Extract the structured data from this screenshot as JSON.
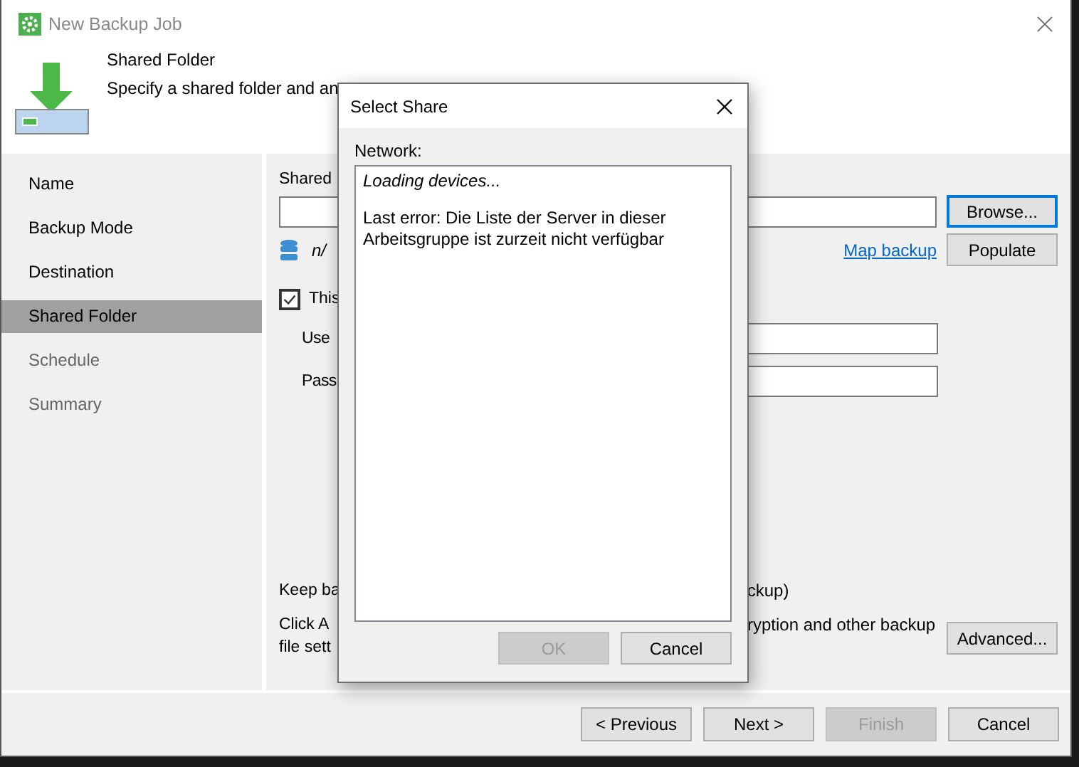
{
  "window": {
    "title": "New Backup Job"
  },
  "header": {
    "title": "Shared Folder",
    "subtitle": "Specify a shared folder and an"
  },
  "steps": [
    {
      "label": "Name",
      "selected": false,
      "disabled": false
    },
    {
      "label": "Backup Mode",
      "selected": false,
      "disabled": false
    },
    {
      "label": "Destination",
      "selected": false,
      "disabled": false
    },
    {
      "label": "Shared Folder",
      "selected": true,
      "disabled": false
    },
    {
      "label": "Schedule",
      "selected": false,
      "disabled": true
    },
    {
      "label": "Summary",
      "selected": false,
      "disabled": true
    }
  ],
  "form": {
    "shared_label": "Shared",
    "browse_button": {
      "label": "Browse...",
      "focused": true
    },
    "repository_value": "n/",
    "map_backup_link": "Map backup",
    "populate_button": "Populate",
    "credentials_checkbox": {
      "label": "This",
      "checked": true
    },
    "username_label": "Use",
    "password_label": "Pass",
    "retention_left": "Keep ba",
    "retention_right": "ckup)",
    "advanced_left_lines": [
      "Click A",
      "file sett"
    ],
    "advanced_right": "ryption and other backup",
    "advanced_button": "Advanced..."
  },
  "footer_buttons": [
    {
      "label": "< Previous",
      "disabled": false
    },
    {
      "label": "Next >",
      "disabled": false
    },
    {
      "label": "Finish",
      "disabled": true
    },
    {
      "label": "Cancel",
      "disabled": false
    }
  ],
  "dialog": {
    "title": "Select Share",
    "network_label": "Network:",
    "loading": "Loading devices...",
    "error": "Last error: Die Liste der Server in dieser Arbeitsgruppe ist zurzeit nicht verfügbar",
    "buttons": [
      {
        "label": "OK",
        "disabled": true
      },
      {
        "label": "Cancel",
        "disabled": false
      }
    ]
  }
}
